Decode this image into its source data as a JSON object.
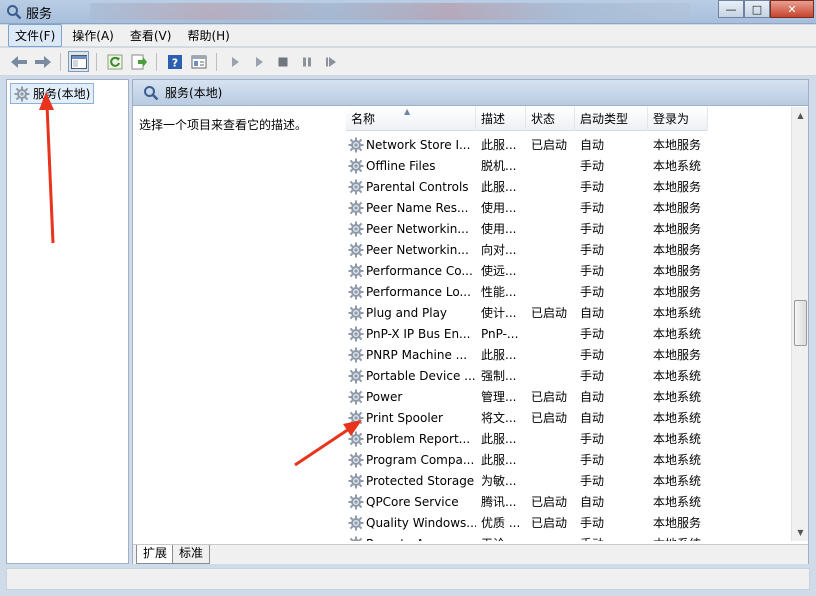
{
  "window": {
    "title": "服务",
    "buttons": {
      "minimize": "—",
      "maximize": "□",
      "close": "✕"
    }
  },
  "menu": [
    {
      "label": "文件(F)",
      "name": "menu-file"
    },
    {
      "label": "操作(A)",
      "name": "menu-action"
    },
    {
      "label": "查看(V)",
      "name": "menu-view"
    },
    {
      "label": "帮助(H)",
      "name": "menu-help"
    }
  ],
  "tree": {
    "root_label": "服务(本地)"
  },
  "right": {
    "header_title": "服务(本地)",
    "description_prompt": "选择一个项目来查看它的描述。"
  },
  "columns": [
    "名称",
    "描述",
    "状态",
    "启动类型",
    "登录为"
  ],
  "services": [
    {
      "name": "Network Store I...",
      "desc": "此服...",
      "status": "已启动",
      "type": "自动",
      "logon": "本地服务"
    },
    {
      "name": "Offline Files",
      "desc": "脱机...",
      "status": "",
      "type": "手动",
      "logon": "本地系统"
    },
    {
      "name": "Parental Controls",
      "desc": "此服...",
      "status": "",
      "type": "手动",
      "logon": "本地服务"
    },
    {
      "name": "Peer Name Res...",
      "desc": "使用...",
      "status": "",
      "type": "手动",
      "logon": "本地服务"
    },
    {
      "name": "Peer Networkin...",
      "desc": "使用...",
      "status": "",
      "type": "手动",
      "logon": "本地服务"
    },
    {
      "name": "Peer Networkin...",
      "desc": "向对...",
      "status": "",
      "type": "手动",
      "logon": "本地服务"
    },
    {
      "name": "Performance Co...",
      "desc": "使远...",
      "status": "",
      "type": "手动",
      "logon": "本地服务"
    },
    {
      "name": "Performance Lo...",
      "desc": "性能...",
      "status": "",
      "type": "手动",
      "logon": "本地服务"
    },
    {
      "name": "Plug and Play",
      "desc": "使计...",
      "status": "已启动",
      "type": "自动",
      "logon": "本地系统"
    },
    {
      "name": "PnP-X IP Bus En...",
      "desc": "PnP-...",
      "status": "",
      "type": "手动",
      "logon": "本地系统"
    },
    {
      "name": "PNRP Machine ...",
      "desc": "此服...",
      "status": "",
      "type": "手动",
      "logon": "本地服务"
    },
    {
      "name": "Portable Device ...",
      "desc": "强制...",
      "status": "",
      "type": "手动",
      "logon": "本地系统"
    },
    {
      "name": "Power",
      "desc": "管理...",
      "status": "已启动",
      "type": "自动",
      "logon": "本地系统"
    },
    {
      "name": "Print Spooler",
      "desc": "将文...",
      "status": "已启动",
      "type": "自动",
      "logon": "本地系统"
    },
    {
      "name": "Problem Report...",
      "desc": "此服...",
      "status": "",
      "type": "手动",
      "logon": "本地系统"
    },
    {
      "name": "Program Compa...",
      "desc": "此服...",
      "status": "",
      "type": "手动",
      "logon": "本地系统"
    },
    {
      "name": "Protected Storage",
      "desc": "为敏...",
      "status": "",
      "type": "手动",
      "logon": "本地系统"
    },
    {
      "name": "QPCore Service",
      "desc": "腾讯...",
      "status": "已启动",
      "type": "自动",
      "logon": "本地系统"
    },
    {
      "name": "Quality Windows...",
      "desc": "优质 ...",
      "status": "已启动",
      "type": "手动",
      "logon": "本地服务"
    },
    {
      "name": "Remote Access ...",
      "desc": "无论...",
      "status": "",
      "type": "手动",
      "logon": "本地系统"
    }
  ],
  "tabs": [
    {
      "label": "扩展"
    },
    {
      "label": "标准"
    }
  ],
  "colors": {
    "annotation_arrow": "#e8341c",
    "selection": "#e3eefb"
  },
  "icons": [
    "services-app-icon",
    "back-icon",
    "forward-icon",
    "console-tree-icon",
    "refresh-icon",
    "export-icon",
    "help-icon",
    "properties-icon",
    "start-icon",
    "start-alt-icon",
    "stop-icon",
    "pause-icon",
    "restart-icon",
    "gear-icon"
  ]
}
